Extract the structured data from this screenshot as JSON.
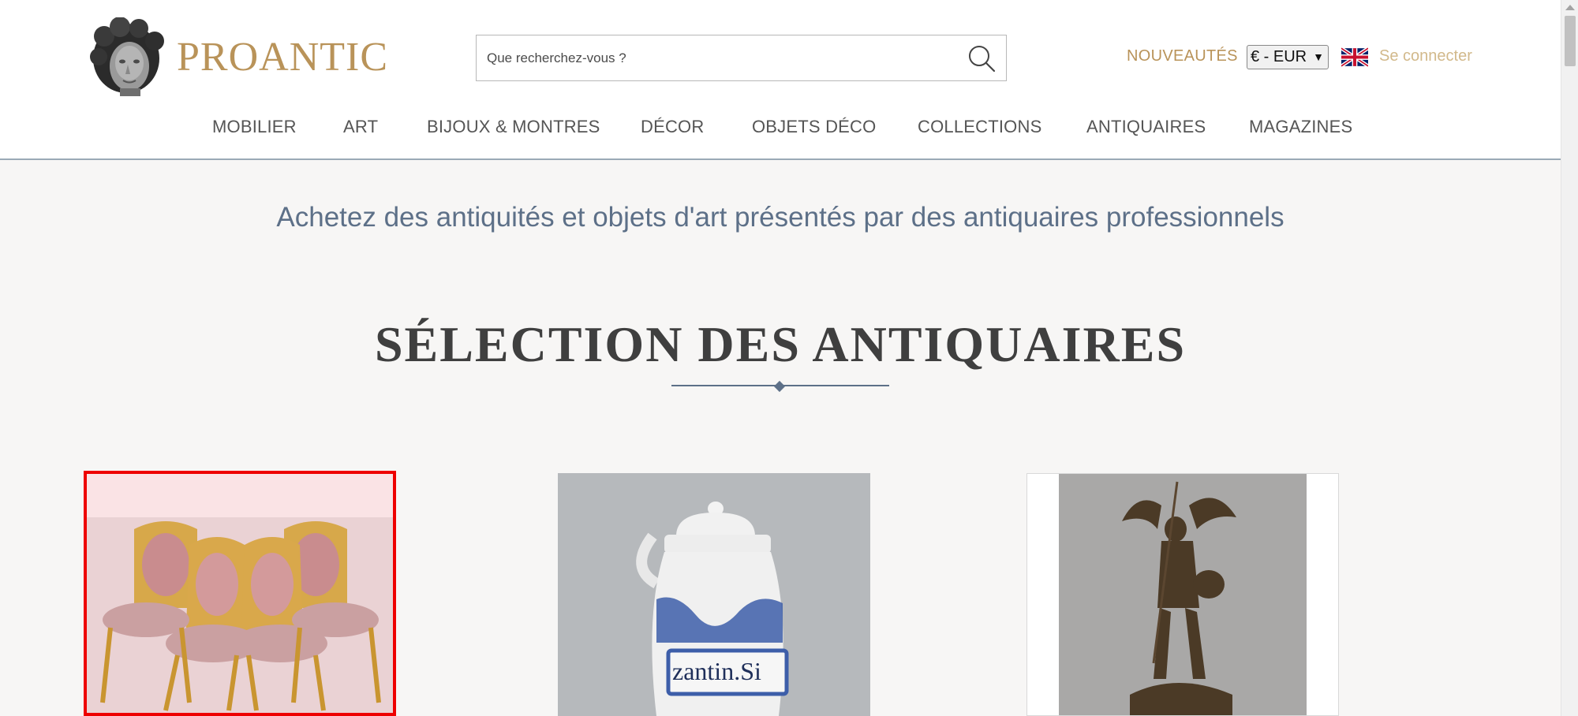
{
  "header": {
    "brand": "PROANTIC",
    "search": {
      "placeholder": "Que recherchez-vous ?"
    },
    "nouveautes": "NOUVEAUTÉS",
    "currency": "€ - EUR",
    "login": "Se connecter",
    "icons": {
      "search": "search-icon",
      "flag": "uk-flag-icon",
      "logo": "cherub-head-logo"
    }
  },
  "nav": {
    "items": [
      {
        "label": "MOBILIER"
      },
      {
        "label": "ART"
      },
      {
        "label": "BIJOUX & MONTRES"
      },
      {
        "label": "DÉCOR"
      },
      {
        "label": "OBJETS DÉCO"
      },
      {
        "label": "COLLECTIONS"
      },
      {
        "label": "ANTIQUAIRES"
      },
      {
        "label": "MAGAZINES"
      }
    ]
  },
  "main": {
    "tagline": "Achetez des antiquités et objets d'art présentés par des antiquaires professionnels",
    "section_title": "SÉLECTION DES ANTIQUAIRES",
    "jar_label": "zantin.Si",
    "colors": {
      "accent_gold": "#b99359",
      "slate_blue": "#5d7088",
      "selection_red": "#ee0000"
    }
  }
}
